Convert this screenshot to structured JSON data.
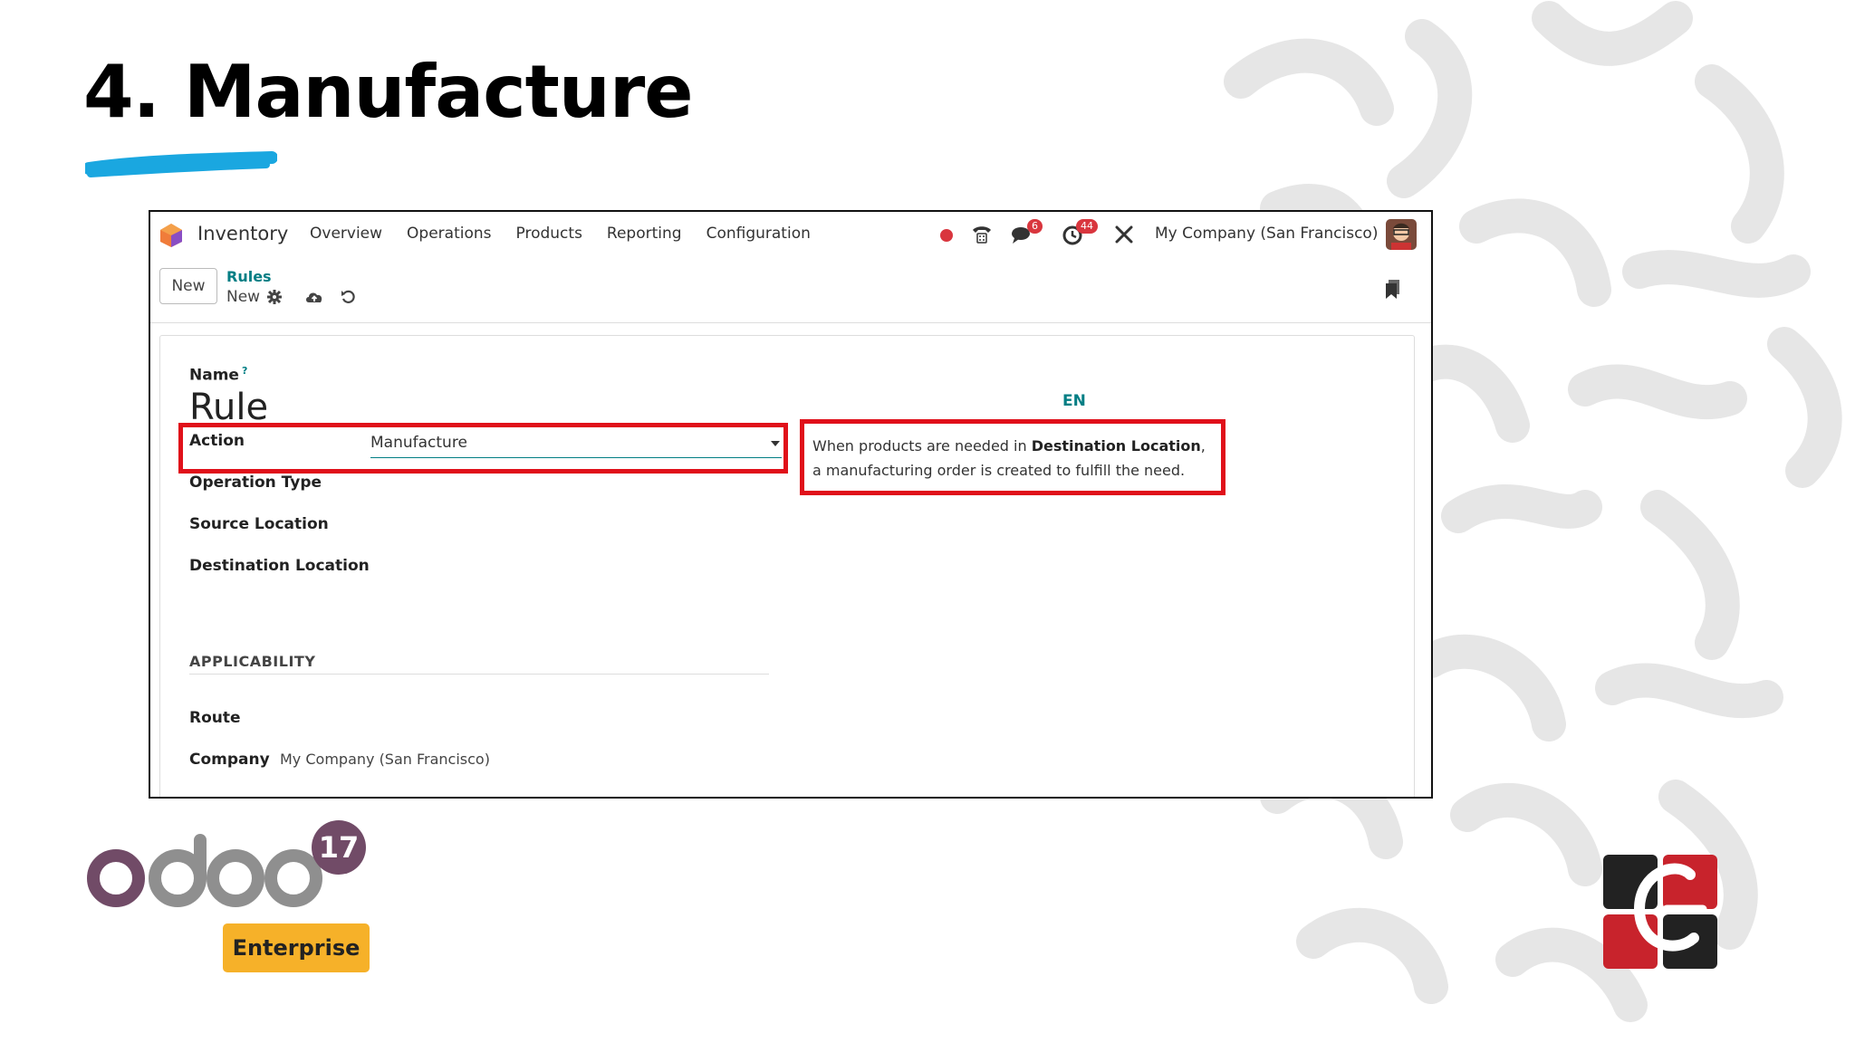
{
  "slide": {
    "title": "4. Manufacture"
  },
  "navbar": {
    "app_name": "Inventory",
    "menu": [
      "Overview",
      "Operations",
      "Products",
      "Reporting",
      "Configuration"
    ],
    "messages_badge": "6",
    "activities_badge": "44",
    "company": "My Company (San Francisco)"
  },
  "control_panel": {
    "new_label": "New",
    "breadcrumb_parent": "Rules",
    "breadcrumb_current": "New"
  },
  "form": {
    "name_label": "Name",
    "name_tooltip_mark": "?",
    "name_value": "Rule",
    "lang_label": "EN",
    "action_label": "Action",
    "action_value": "Manufacture",
    "help_prefix": "When products are needed in ",
    "help_bold": "Destination Location",
    "help_suffix": ",",
    "help_line2": "a manufacturing order is created to fulfill the need.",
    "operation_type_label": "Operation Type",
    "source_location_label": "Source Location",
    "destination_location_label": "Destination Location",
    "applicability_title": "APPLICABILITY",
    "route_label": "Route",
    "company_label": "Company",
    "company_value": "My Company (San Francisco)"
  },
  "branding": {
    "odoo_version": "17",
    "edition": "Enterprise"
  },
  "colors": {
    "accent_teal": "#017e84",
    "highlight_red": "#e0101a",
    "underline_blue": "#1aa7e0",
    "enterprise_yellow": "#f6b129",
    "odoo_purple": "#714b67",
    "odoo_grey": "#8f8f8f"
  }
}
